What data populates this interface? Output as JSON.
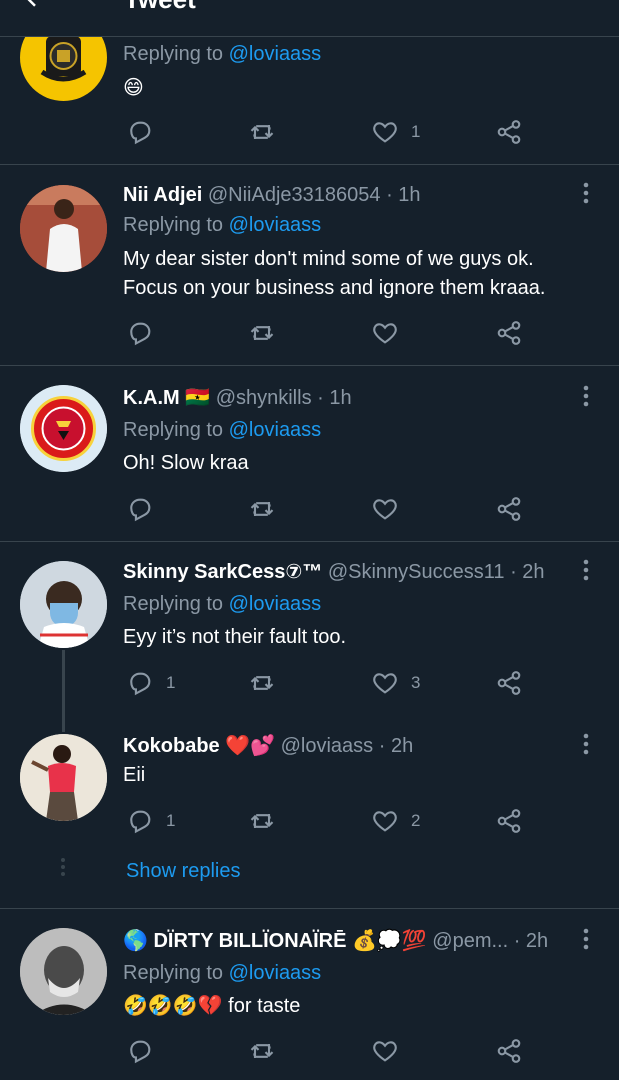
{
  "header": {
    "title": "Tweet"
  },
  "tweets": [
    {
      "reply_prefix": "Replying to",
      "reply_to": "@loviaass",
      "text": "😄",
      "actions": {
        "replies": "",
        "retweets": "",
        "likes": "1"
      }
    },
    {
      "name": "Nii Adjei",
      "handle": "@NiiAdje33186054",
      "time": "· 1h",
      "reply_prefix": "Replying to",
      "reply_to": "@loviaass",
      "text_lines": [
        "My dear sister don't mind some of we guys ok.",
        "Focus on your  business and ignore them kraaa."
      ],
      "actions": {
        "replies": "",
        "retweets": "",
        "likes": ""
      }
    },
    {
      "name": "K.A.M 🇬🇭",
      "handle": "@shynkills",
      "time": "· 1h",
      "reply_prefix": "Replying to",
      "reply_to": "@loviaass",
      "text": "Oh! Slow kraa",
      "actions": {
        "replies": "",
        "retweets": "",
        "likes": ""
      }
    },
    {
      "name": "Skinny SarkCess⑦™",
      "handle": "@SkinnySuccess11",
      "time": "· 2h",
      "reply_prefix": "Replying to",
      "reply_to": "@loviaass",
      "text": "Eyy it’s not their fault too.",
      "actions": {
        "replies": "1",
        "retweets": "",
        "likes": "3"
      }
    },
    {
      "name": "Kokobabe ❤️💕",
      "handle": "@loviaass",
      "time": "· 2h",
      "text": "Eii",
      "actions": {
        "replies": "1",
        "retweets": "",
        "likes": "2"
      }
    },
    {
      "name": "🌎 DÏRTY BILLÏONAÏRĒ 💰💭💯",
      "handle": "@pem...",
      "time": "· 2h",
      "reply_prefix": "Replying to",
      "reply_to": "@loviaass",
      "text": "🤣🤣🤣💔 for taste",
      "actions": {
        "replies": "",
        "retweets": "",
        "likes": ""
      }
    }
  ],
  "show_replies": "Show replies",
  "colors": {
    "background": "#15202b",
    "accent": "#1d9bf0",
    "muted": "#8b98a5",
    "divider": "#38444d"
  }
}
